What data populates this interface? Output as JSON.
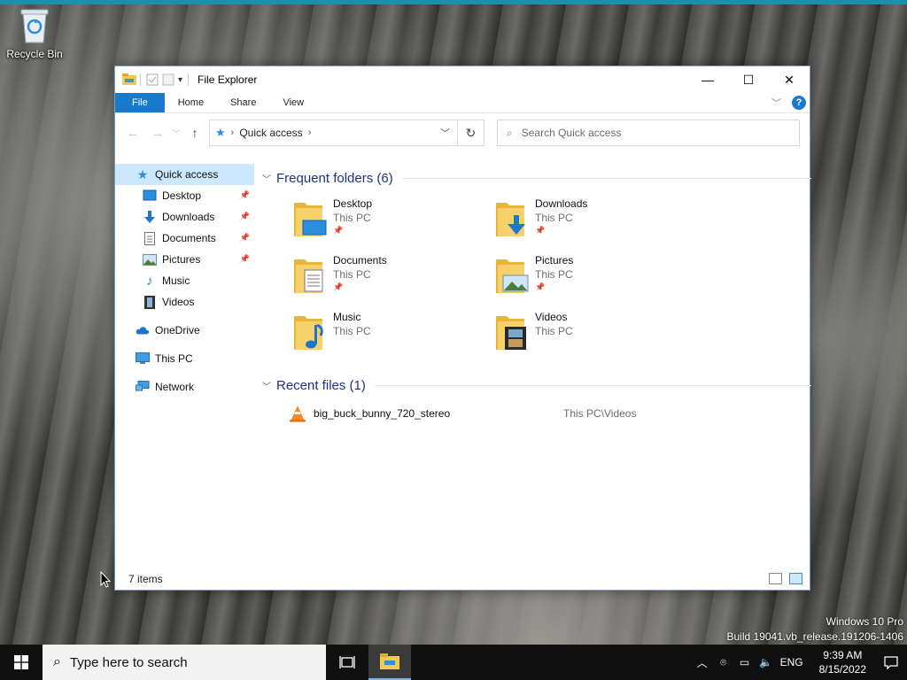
{
  "desktop": {
    "recycle_bin_label": "Recycle Bin",
    "watermark_line1": "Windows 10 Pro",
    "watermark_line2": "Build 19041.vb_release.191206-1406"
  },
  "window": {
    "title": "File Explorer",
    "controls": {
      "minimize": "—",
      "maximize": "☐",
      "close": "✕"
    }
  },
  "ribbon": {
    "tabs": [
      {
        "label": "File"
      },
      {
        "label": "Home"
      },
      {
        "label": "Share"
      },
      {
        "label": "View"
      }
    ],
    "help": "?"
  },
  "address_bar": {
    "location": "Quick access",
    "search_placeholder": "Search Quick access"
  },
  "nav_pane": {
    "quick_access": "Quick access",
    "items": [
      {
        "label": "Desktop",
        "icon": "desktop-icon",
        "pinned": true
      },
      {
        "label": "Downloads",
        "icon": "download-arrow-icon",
        "pinned": true
      },
      {
        "label": "Documents",
        "icon": "document-icon",
        "pinned": true
      },
      {
        "label": "Pictures",
        "icon": "pictures-icon",
        "pinned": true
      },
      {
        "label": "Music",
        "icon": "music-note-icon",
        "pinned": false
      },
      {
        "label": "Videos",
        "icon": "film-icon",
        "pinned": false
      }
    ],
    "onedrive": "OneDrive",
    "this_pc": "This PC",
    "network": "Network"
  },
  "content": {
    "frequent_header": "Frequent folders (6)",
    "folders": [
      {
        "name": "Desktop",
        "location": "This PC",
        "pinned": true
      },
      {
        "name": "Downloads",
        "location": "This PC",
        "pinned": true
      },
      {
        "name": "Documents",
        "location": "This PC",
        "pinned": true
      },
      {
        "name": "Pictures",
        "location": "This PC",
        "pinned": true
      },
      {
        "name": "Music",
        "location": "This PC",
        "pinned": false
      },
      {
        "name": "Videos",
        "location": "This PC",
        "pinned": false
      }
    ],
    "recent_header": "Recent files (1)",
    "recent_files": [
      {
        "name": "big_buck_bunny_720_stereo",
        "path": "This PC\\Videos",
        "icon": "vlc-cone-icon"
      }
    ]
  },
  "status_bar": {
    "count": "7 items"
  },
  "taskbar": {
    "search_placeholder": "Type here to search",
    "language": "ENG",
    "time": "9:39 AM",
    "date": "8/15/2022"
  },
  "colors": {
    "accent": "#1979ca",
    "selection": "#cce8ff",
    "group_header": "#1e3287",
    "folder_yellow": "#f5c94a"
  }
}
